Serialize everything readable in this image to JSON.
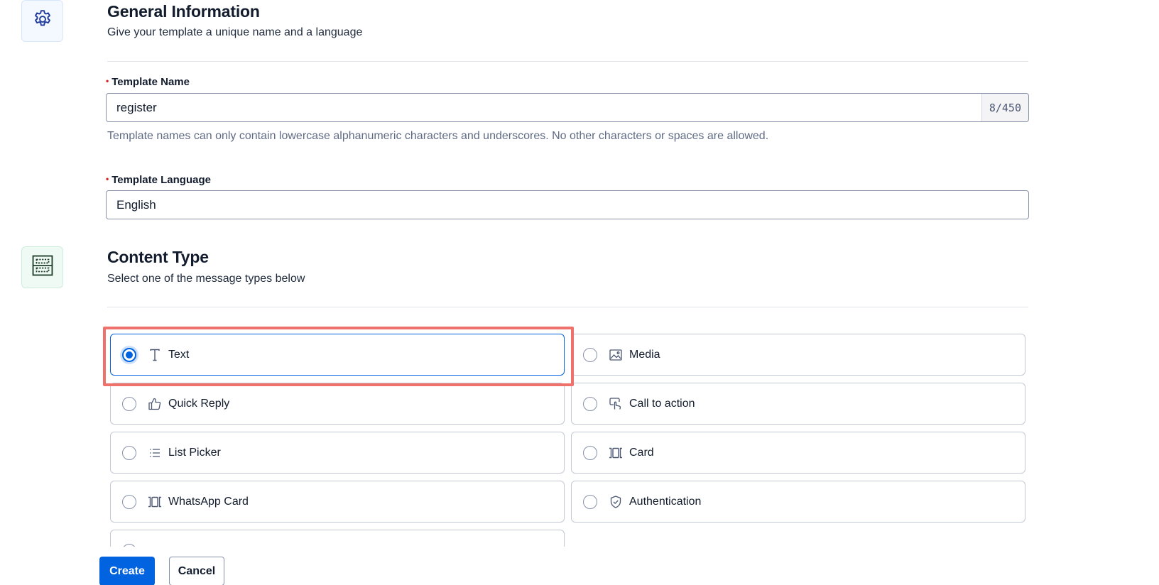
{
  "general": {
    "title": "General Information",
    "subtitle": "Give your template a unique name and a language",
    "icon": "gear-icon"
  },
  "template_name": {
    "label": "Template Name",
    "value": "register",
    "counter": "8/450",
    "help": "Template names can only contain lowercase alphanumeric characters and underscores. No other characters or spaces are allowed."
  },
  "template_language": {
    "label": "Template Language",
    "value": "English"
  },
  "content_type": {
    "title": "Content Type",
    "subtitle": "Select one of the message types below",
    "icon": "layout-icon",
    "selected": "Text",
    "options": [
      {
        "label": "Text",
        "icon": "text-icon"
      },
      {
        "label": "Media",
        "icon": "image-icon"
      },
      {
        "label": "Quick Reply",
        "icon": "thumbs-up-icon"
      },
      {
        "label": "Call to action",
        "icon": "tap-icon"
      },
      {
        "label": "List Picker",
        "icon": "list-icon"
      },
      {
        "label": "Card",
        "icon": "card-icon"
      },
      {
        "label": "WhatsApp Card",
        "icon": "card-icon"
      },
      {
        "label": "Authentication",
        "icon": "shield-check-icon"
      }
    ]
  },
  "actions": {
    "create_label": "Create",
    "cancel_label": "Cancel"
  },
  "colors": {
    "primary": "#0263e0",
    "highlight": "#f0706c",
    "required": "#d61f1f"
  }
}
